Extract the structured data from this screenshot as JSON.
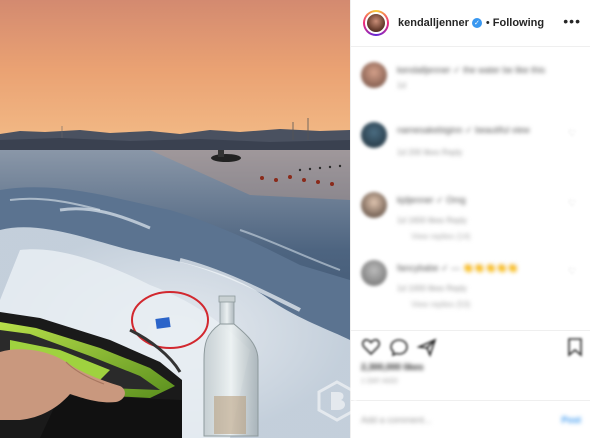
{
  "post": {
    "username": "kendalljenner",
    "separator": "•",
    "follow_status": "Following",
    "more_icon": "more-options-icon"
  },
  "comments": [
    {
      "text": "kendalljenner ✓ the water be like this",
      "meta": "1d",
      "reply": ""
    },
    {
      "text": "namesakebiginn ✓ beautiful view",
      "meta": "1d    200 likes    Reply",
      "reply": ""
    },
    {
      "text": "kjdjenner ✓ Omg",
      "meta": "1d    1600 likes    Reply",
      "reply": "View replies (14)"
    },
    {
      "text": "fancybabe ✓ — 👏👏👏👏👏",
      "meta": "1d    1000 likes    Reply",
      "reply": "View replies (53)"
    }
  ],
  "footer": {
    "likes_text": "2,300,000 likes",
    "date_text": "1 DAY AGO",
    "comment_placeholder": "Add a comment...",
    "post_label": "Post"
  },
  "colors": {
    "accent": "#3897f0",
    "text": "#262626",
    "border": "#efefef",
    "circle_annotation": "#d2282f"
  }
}
